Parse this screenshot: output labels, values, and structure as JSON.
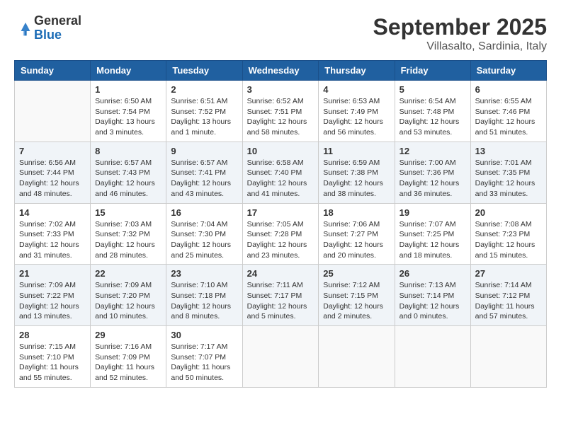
{
  "logo": {
    "general": "General",
    "blue": "Blue"
  },
  "title": "September 2025",
  "location": "Villasalto, Sardinia, Italy",
  "days_of_week": [
    "Sunday",
    "Monday",
    "Tuesday",
    "Wednesday",
    "Thursday",
    "Friday",
    "Saturday"
  ],
  "weeks": [
    [
      {
        "day": "",
        "info": ""
      },
      {
        "day": "1",
        "info": "Sunrise: 6:50 AM\nSunset: 7:54 PM\nDaylight: 13 hours\nand 3 minutes."
      },
      {
        "day": "2",
        "info": "Sunrise: 6:51 AM\nSunset: 7:52 PM\nDaylight: 13 hours\nand 1 minute."
      },
      {
        "day": "3",
        "info": "Sunrise: 6:52 AM\nSunset: 7:51 PM\nDaylight: 12 hours\nand 58 minutes."
      },
      {
        "day": "4",
        "info": "Sunrise: 6:53 AM\nSunset: 7:49 PM\nDaylight: 12 hours\nand 56 minutes."
      },
      {
        "day": "5",
        "info": "Sunrise: 6:54 AM\nSunset: 7:48 PM\nDaylight: 12 hours\nand 53 minutes."
      },
      {
        "day": "6",
        "info": "Sunrise: 6:55 AM\nSunset: 7:46 PM\nDaylight: 12 hours\nand 51 minutes."
      }
    ],
    [
      {
        "day": "7",
        "info": "Sunrise: 6:56 AM\nSunset: 7:44 PM\nDaylight: 12 hours\nand 48 minutes."
      },
      {
        "day": "8",
        "info": "Sunrise: 6:57 AM\nSunset: 7:43 PM\nDaylight: 12 hours\nand 46 minutes."
      },
      {
        "day": "9",
        "info": "Sunrise: 6:57 AM\nSunset: 7:41 PM\nDaylight: 12 hours\nand 43 minutes."
      },
      {
        "day": "10",
        "info": "Sunrise: 6:58 AM\nSunset: 7:40 PM\nDaylight: 12 hours\nand 41 minutes."
      },
      {
        "day": "11",
        "info": "Sunrise: 6:59 AM\nSunset: 7:38 PM\nDaylight: 12 hours\nand 38 minutes."
      },
      {
        "day": "12",
        "info": "Sunrise: 7:00 AM\nSunset: 7:36 PM\nDaylight: 12 hours\nand 36 minutes."
      },
      {
        "day": "13",
        "info": "Sunrise: 7:01 AM\nSunset: 7:35 PM\nDaylight: 12 hours\nand 33 minutes."
      }
    ],
    [
      {
        "day": "14",
        "info": "Sunrise: 7:02 AM\nSunset: 7:33 PM\nDaylight: 12 hours\nand 31 minutes."
      },
      {
        "day": "15",
        "info": "Sunrise: 7:03 AM\nSunset: 7:32 PM\nDaylight: 12 hours\nand 28 minutes."
      },
      {
        "day": "16",
        "info": "Sunrise: 7:04 AM\nSunset: 7:30 PM\nDaylight: 12 hours\nand 25 minutes."
      },
      {
        "day": "17",
        "info": "Sunrise: 7:05 AM\nSunset: 7:28 PM\nDaylight: 12 hours\nand 23 minutes."
      },
      {
        "day": "18",
        "info": "Sunrise: 7:06 AM\nSunset: 7:27 PM\nDaylight: 12 hours\nand 20 minutes."
      },
      {
        "day": "19",
        "info": "Sunrise: 7:07 AM\nSunset: 7:25 PM\nDaylight: 12 hours\nand 18 minutes."
      },
      {
        "day": "20",
        "info": "Sunrise: 7:08 AM\nSunset: 7:23 PM\nDaylight: 12 hours\nand 15 minutes."
      }
    ],
    [
      {
        "day": "21",
        "info": "Sunrise: 7:09 AM\nSunset: 7:22 PM\nDaylight: 12 hours\nand 13 minutes."
      },
      {
        "day": "22",
        "info": "Sunrise: 7:09 AM\nSunset: 7:20 PM\nDaylight: 12 hours\nand 10 minutes."
      },
      {
        "day": "23",
        "info": "Sunrise: 7:10 AM\nSunset: 7:18 PM\nDaylight: 12 hours\nand 8 minutes."
      },
      {
        "day": "24",
        "info": "Sunrise: 7:11 AM\nSunset: 7:17 PM\nDaylight: 12 hours\nand 5 minutes."
      },
      {
        "day": "25",
        "info": "Sunrise: 7:12 AM\nSunset: 7:15 PM\nDaylight: 12 hours\nand 2 minutes."
      },
      {
        "day": "26",
        "info": "Sunrise: 7:13 AM\nSunset: 7:14 PM\nDaylight: 12 hours\nand 0 minutes."
      },
      {
        "day": "27",
        "info": "Sunrise: 7:14 AM\nSunset: 7:12 PM\nDaylight: 11 hours\nand 57 minutes."
      }
    ],
    [
      {
        "day": "28",
        "info": "Sunrise: 7:15 AM\nSunset: 7:10 PM\nDaylight: 11 hours\nand 55 minutes."
      },
      {
        "day": "29",
        "info": "Sunrise: 7:16 AM\nSunset: 7:09 PM\nDaylight: 11 hours\nand 52 minutes."
      },
      {
        "day": "30",
        "info": "Sunrise: 7:17 AM\nSunset: 7:07 PM\nDaylight: 11 hours\nand 50 minutes."
      },
      {
        "day": "",
        "info": ""
      },
      {
        "day": "",
        "info": ""
      },
      {
        "day": "",
        "info": ""
      },
      {
        "day": "",
        "info": ""
      }
    ]
  ]
}
